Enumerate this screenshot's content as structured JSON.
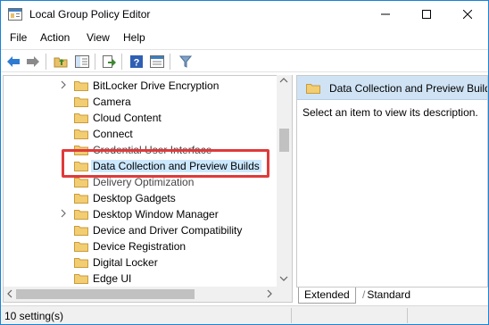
{
  "window": {
    "title": "Local Group Policy Editor",
    "min_glyph": "—",
    "max_glyph": "☐",
    "close_glyph": "✕"
  },
  "menu": {
    "file": "File",
    "action": "Action",
    "view": "View",
    "help": "Help"
  },
  "toolbar": {
    "icons": [
      "back-arrow-icon",
      "forward-arrow-icon",
      "up-folder-icon",
      "show-hide-tree-icon",
      "export-list-icon",
      "help-icon",
      "properties-icon",
      "filter-icon"
    ]
  },
  "tree": {
    "items": [
      {
        "label": "BitLocker Drive Encryption",
        "expandable": true
      },
      {
        "label": "Camera",
        "expandable": false
      },
      {
        "label": "Cloud Content",
        "expandable": false
      },
      {
        "label": "Connect",
        "expandable": false
      },
      {
        "label": "Credential User Interface",
        "expandable": false
      },
      {
        "label": "Data Collection and Preview Builds",
        "expandable": false,
        "selected": true
      },
      {
        "label": "Delivery Optimization",
        "expandable": false
      },
      {
        "label": "Desktop Gadgets",
        "expandable": false
      },
      {
        "label": "Desktop Window Manager",
        "expandable": true
      },
      {
        "label": "Device and Driver Compatibility",
        "expandable": false
      },
      {
        "label": "Device Registration",
        "expandable": false
      },
      {
        "label": "Digital Locker",
        "expandable": false
      },
      {
        "label": "Edge UI",
        "expandable": false
      }
    ]
  },
  "details": {
    "header": "Data Collection and Preview Builds",
    "description": "Select an item to view its description."
  },
  "tabs": {
    "extended": "Extended",
    "standard": "Standard"
  },
  "status": {
    "text": "10 setting(s)"
  },
  "colors": {
    "highlight_box": "#e03a3a",
    "header_bg": "#cfe3f5",
    "folder": "#e8c16a"
  }
}
